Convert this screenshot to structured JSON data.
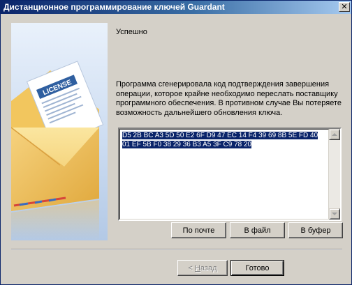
{
  "window": {
    "title": "Дистанционное программирование ключей Guardant"
  },
  "illustration": {
    "icon": "license-envelope-icon",
    "license_label": "LICENSE"
  },
  "content": {
    "heading": "Успешно",
    "description": "Программа сгенерировала код подтверждения завершения операции, которое крайне необходимо переслать поставщику программного обеспечения. В противном случае Вы потеряете возможность дальнейшего обновления ключа.",
    "code_lines": [
      "D5 2B BC A3 5D 50 E2 6F D9 47 EC 14 F4 39 69 8B 5E FD 40",
      "01 EF 5B F0 38 29 36 B3 A5 3F C9 78 20"
    ]
  },
  "actions": {
    "email": "По почте",
    "to_file": "В файл",
    "to_clipboard": "В буфер"
  },
  "footer": {
    "back_arrow": "< ",
    "back_accel": "Н",
    "back_rest": "азад",
    "finish": "Готово"
  },
  "colors": {
    "title_active": "#0a246a",
    "selection": "#0a246a",
    "face": "#d4d0c8"
  }
}
